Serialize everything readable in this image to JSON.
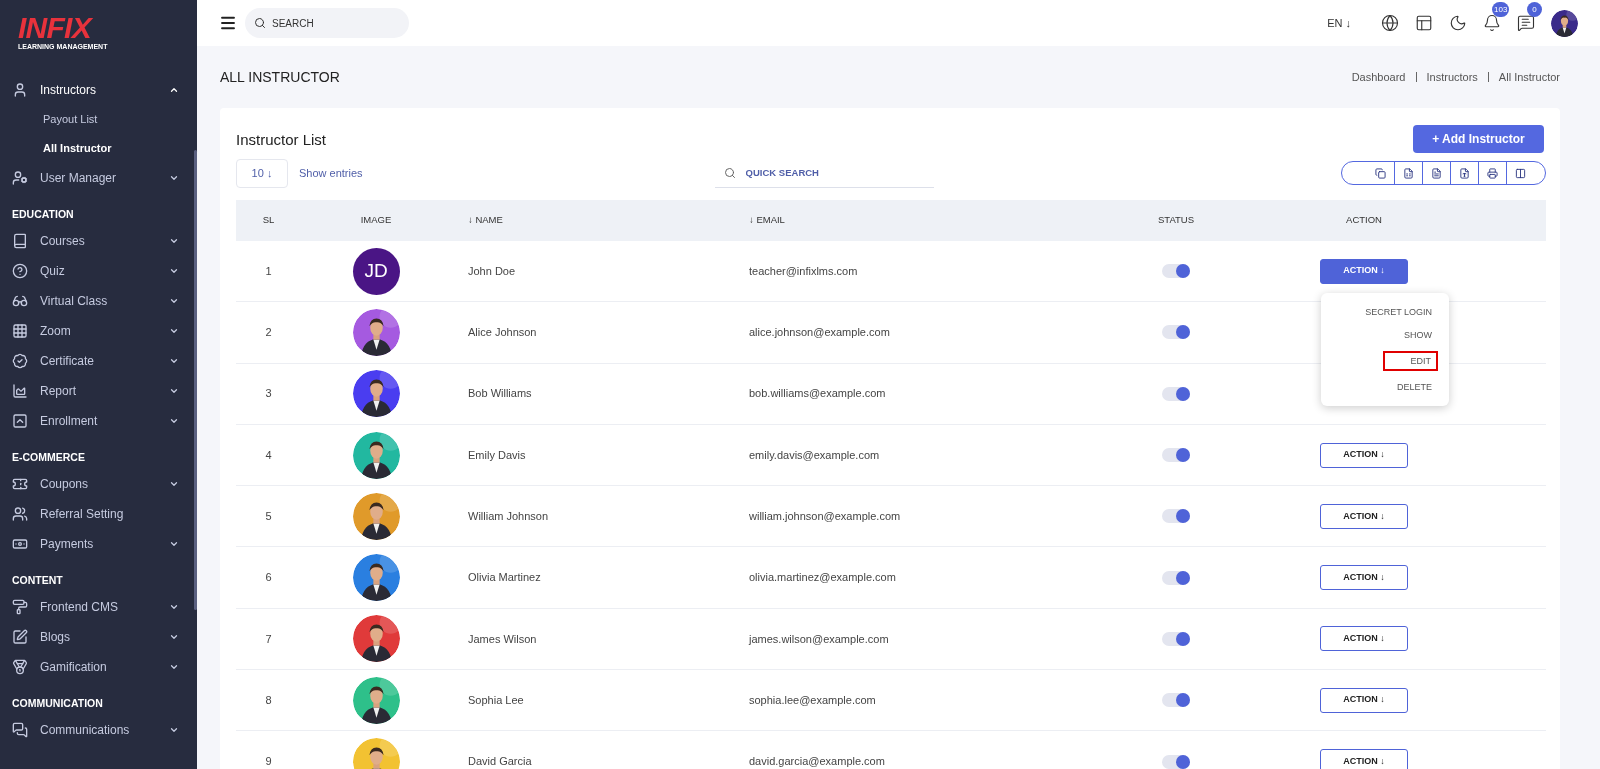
{
  "sidebar": {
    "logo": {
      "brand": "INFIX",
      "tagline": "LEARNING MANAGEMENT"
    },
    "sections": [
      {
        "items": [
          {
            "label": "Instructors",
            "expanded": true,
            "children": [
              {
                "label": "Payout List",
                "selected": false
              },
              {
                "label": "All Instructor",
                "selected": true
              }
            ]
          },
          {
            "label": "User Manager",
            "expanded": false
          }
        ]
      },
      {
        "title": "EDUCATION",
        "items": [
          {
            "label": "Courses",
            "expanded": false
          },
          {
            "label": "Quiz",
            "expanded": false
          },
          {
            "label": "Virtual Class",
            "expanded": false
          },
          {
            "label": "Zoom",
            "expanded": false
          },
          {
            "label": "Certificate",
            "expanded": false
          },
          {
            "label": "Report",
            "expanded": false
          },
          {
            "label": "Enrollment",
            "expanded": false
          }
        ]
      },
      {
        "title": "E-COMMERCE",
        "items": [
          {
            "label": "Coupons",
            "expanded": false
          },
          {
            "label": "Referral Setting"
          },
          {
            "label": "Payments",
            "expanded": false
          }
        ]
      },
      {
        "title": "CONTENT",
        "items": [
          {
            "label": "Frontend CMS",
            "expanded": false
          },
          {
            "label": "Blogs",
            "expanded": false
          },
          {
            "label": "Gamification",
            "expanded": false
          }
        ]
      },
      {
        "title": "COMMUNICATION",
        "items": [
          {
            "label": "Communications",
            "expanded": false
          }
        ]
      }
    ]
  },
  "topbar": {
    "search": {
      "placeholder": "SEARCH"
    },
    "language": "EN ↓",
    "notifications": "103",
    "messages": "0"
  },
  "page": {
    "title": "ALL INSTRUCTOR",
    "breadcrumb": [
      "Dashboard",
      "Instructors",
      "All Instructor"
    ]
  },
  "card": {
    "title": "Instructor List",
    "add_button": "+ Add Instructor",
    "entries": {
      "value": "10 ↓",
      "label": "Show entries"
    },
    "quick_search": {
      "placeholder": "QUICK SEARCH"
    },
    "table": {
      "columns": [
        "SL",
        "IMAGE",
        "↓ NAME",
        "↓ EMAIL",
        "STATUS",
        "ACTION"
      ],
      "rows": [
        {
          "sl": "1",
          "avatar": {
            "kind": "initials",
            "text": "JD"
          },
          "name": "John Doe",
          "email": "teacher@infixlms.com",
          "on": true,
          "action": "ACTION ↓",
          "open": true
        },
        {
          "sl": "2",
          "name": "Alice Johnson",
          "email": "alice.johnson@example.com",
          "on": true
        },
        {
          "sl": "3",
          "name": "Bob Williams",
          "email": "bob.williams@example.com",
          "on": true
        },
        {
          "sl": "4",
          "name": "Emily Davis",
          "email": "emily.davis@example.com",
          "on": true,
          "action": "ACTION ↓",
          "open": false
        },
        {
          "sl": "5",
          "name": "William Johnson",
          "email": "william.johnson@example.com",
          "on": true,
          "action": "ACTION ↓",
          "open": false
        },
        {
          "sl": "6",
          "name": "Olivia Martinez",
          "email": "olivia.martinez@example.com",
          "on": true,
          "action": "ACTION ↓",
          "open": false
        },
        {
          "sl": "7",
          "name": "James Wilson",
          "email": "james.wilson@example.com",
          "on": true,
          "action": "ACTION ↓",
          "open": false
        },
        {
          "sl": "8",
          "name": "Sophia Lee",
          "email": "sophia.lee@example.com",
          "on": true,
          "action": "ACTION ↓",
          "open": false
        },
        {
          "sl": "9",
          "name": "David Garcia",
          "email": "david.garcia@example.com",
          "on": true,
          "action": "ACTION ↓",
          "open": false
        }
      ]
    },
    "action_menu": [
      {
        "label": "SECRET LOGIN",
        "highlighted": false
      },
      {
        "label": "SHOW",
        "highlighted": false
      },
      {
        "label": "EDIT",
        "highlighted": true
      },
      {
        "label": "DELETE",
        "highlighted": false
      }
    ]
  }
}
